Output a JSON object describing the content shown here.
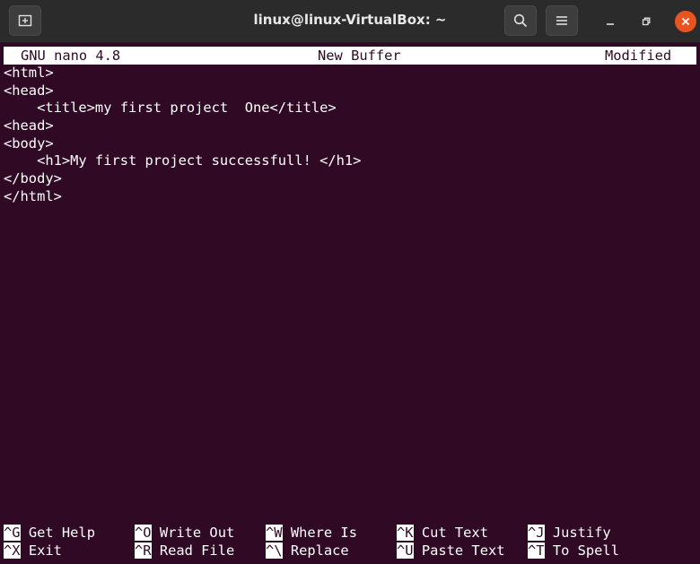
{
  "window": {
    "title": "linux@linux-VirtualBox: ~",
    "icons": {
      "new_tab": "new-tab-icon",
      "search": "search-icon",
      "menu": "hamburger-menu-icon",
      "minimize": "minimize-icon",
      "maximize": "restore-icon",
      "close": "close-icon"
    },
    "colors": {
      "terminal_bg": "#300a24",
      "titlebar_bg": "#2b2b2b",
      "close_button": "#e95420"
    }
  },
  "nano": {
    "header": {
      "app_version": "GNU nano 4.8",
      "filename": "New Buffer",
      "status": "Modified"
    },
    "buffer_lines": [
      "<html>",
      "<head>",
      "    <title>my first project  One</title>",
      "<head>",
      "<body>",
      "    <h1>My first project successfull! </h1>",
      "</body>",
      "</html>"
    ],
    "shortcuts": [
      {
        "key": "^G",
        "label": "Get Help"
      },
      {
        "key": "^O",
        "label": "Write Out"
      },
      {
        "key": "^W",
        "label": "Where Is"
      },
      {
        "key": "^K",
        "label": "Cut Text"
      },
      {
        "key": "^J",
        "label": "Justify"
      },
      {
        "key": "^X",
        "label": "Exit"
      },
      {
        "key": "^R",
        "label": "Read File"
      },
      {
        "key": "^\\",
        "label": "Replace"
      },
      {
        "key": "^U",
        "label": "Paste Text"
      },
      {
        "key": "^T",
        "label": "To Spell"
      }
    ]
  }
}
